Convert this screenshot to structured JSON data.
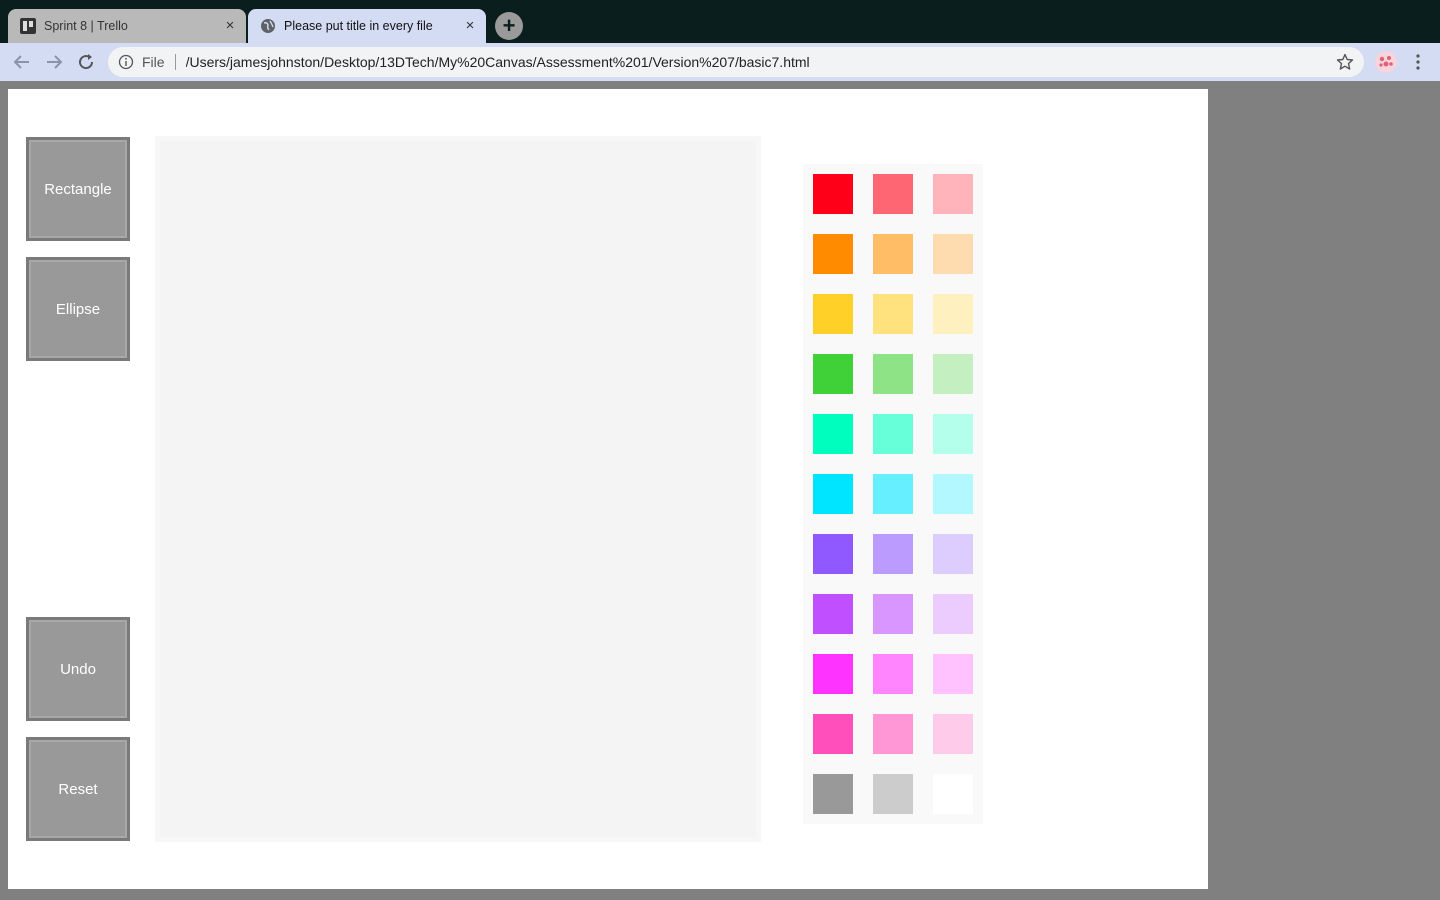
{
  "browser": {
    "tabs": [
      {
        "title": "Sprint 8 | Trello",
        "close": "×"
      },
      {
        "title": "Please put title in every file",
        "close": "×"
      }
    ],
    "newtab": "+",
    "omnibox": {
      "scheme": "File",
      "url": "/Users/jamesjohnston/Desktop/13DTech/My%20Canvas/Assessment%201/Version%207/basic7.html"
    }
  },
  "tools": {
    "rectangle": "Rectangle",
    "ellipse": "Ellipse",
    "undo": "Undo",
    "reset": "Reset"
  },
  "palette": {
    "colors": [
      [
        "#ff0019",
        "#ff6674",
        "#ffb3ba"
      ],
      [
        "#ff8c00",
        "#ffbe66",
        "#ffdcb0"
      ],
      [
        "#ffd027",
        "#ffe27d",
        "#fff0c0"
      ],
      [
        "#40d037",
        "#8fe387",
        "#c4f0c1"
      ],
      [
        "#00ffbf",
        "#66ffd9",
        "#b3ffec"
      ],
      [
        "#00e5ff",
        "#66efff",
        "#b3f7ff"
      ],
      [
        "#9058ff",
        "#bc9bff",
        "#ddcdff"
      ],
      [
        "#bf4fff",
        "#d996ff",
        "#ecccff"
      ],
      [
        "#ff33ff",
        "#ff85ff",
        "#ffc2ff"
      ],
      [
        "#ff4fba",
        "#ff96d6",
        "#ffcbea"
      ],
      [
        "#999999",
        "#cccccc",
        "#ffffff"
      ]
    ]
  }
}
